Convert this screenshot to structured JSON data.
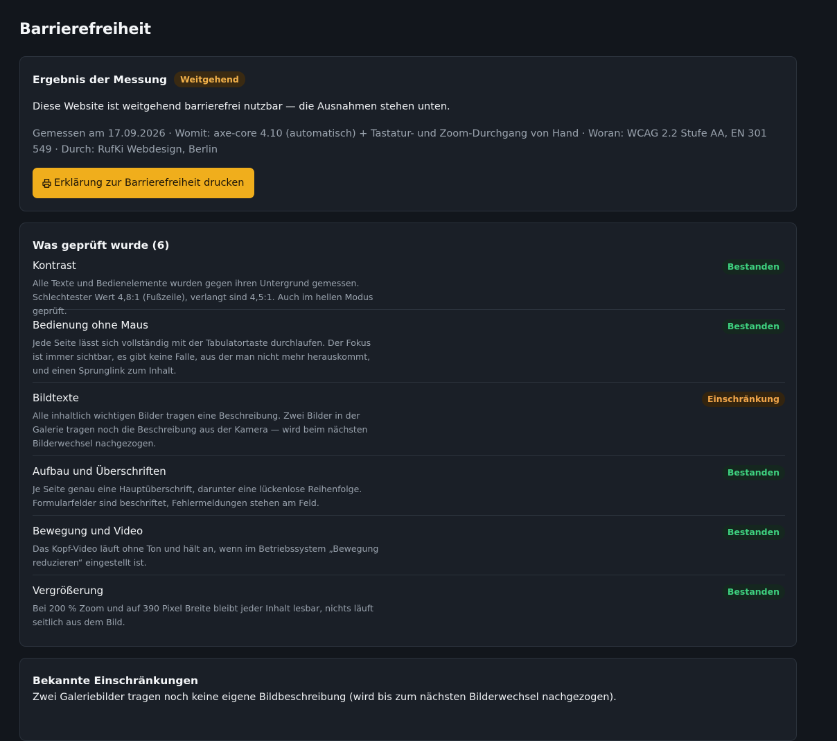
{
  "page": {
    "title": "Barrierefreiheit"
  },
  "result": {
    "title": "Ergebnis der Messung",
    "badge": "Weitgehend",
    "summary": "Diese Website ist weitgehend barrierefrei nutzbar — die Ausnahmen stehen unten.",
    "meta": "Gemessen am 17.09.2026 · Womit: axe-core 4.10 (automatisch) + Tastatur- und Zoom-Durchgang von Hand · Woran: WCAG 2.2 Stufe AA, EN 301 549 · Durch: RufKi Webdesign, Berlin",
    "print_label": "Erklärung zur Barrierefreiheit drucken",
    "print_icon": "printer-icon"
  },
  "checks": {
    "title": "Was geprüft wurde (6)",
    "items": [
      {
        "name": "Kontrast",
        "desc": "Alle Texte und Bedienelemente wurden gegen ihren Untergrund gemessen. Schlechtester Wert 4,8:1 (Fußzeile), verlangt sind 4,5:1. Auch im hellen Modus geprüft.",
        "status": "Bestanden"
      },
      {
        "name": "Bedienung ohne Maus",
        "desc": "Jede Seite lässt sich vollständig mit der Tabulatortaste durchlaufen. Der Fokus ist immer sichtbar, es gibt keine Falle, aus der man nicht mehr herauskommt, und einen Sprunglink zum Inhalt.",
        "status": "Bestanden"
      },
      {
        "name": "Bildtexte",
        "desc": "Alle inhaltlich wichtigen Bilder tragen eine Beschreibung. Zwei Bilder in der Galerie tragen noch die Beschreibung aus der Kamera — wird beim nächsten Bilderwechsel nachgezogen.",
        "status": "Einschränkung"
      },
      {
        "name": "Aufbau und Überschriften",
        "desc": "Je Seite genau eine Hauptüberschrift, darunter eine lückenlose Reihenfolge. Formularfelder sind beschriftet, Fehlermeldungen stehen am Feld.",
        "status": "Bestanden"
      },
      {
        "name": "Bewegung und Video",
        "desc": "Das Kopf-Video läuft ohne Ton und hält an, wenn im Betriebssystem „Bewegung reduzieren“ eingestellt ist.",
        "status": "Bestanden"
      },
      {
        "name": "Vergrößerung",
        "desc": "Bei 200 % Zoom und auf 390 Pixel Breite bleibt jeder Inhalt lesbar, nichts läuft seitlich aus dem Bild.",
        "status": "Bestanden"
      }
    ]
  },
  "limits": {
    "title": "Bekannte Einschränkungen",
    "text": "Zwei Galeriebilder tragen noch keine eigene Bildbeschreibung (wird bis zum nächsten Bilderwechsel nachgezogen)."
  },
  "colors": {
    "background": "#12161c",
    "card": "#1a1f27",
    "accent": "#f0ae1c",
    "pass": "#3ed17f",
    "warn": "#f2a64a"
  }
}
